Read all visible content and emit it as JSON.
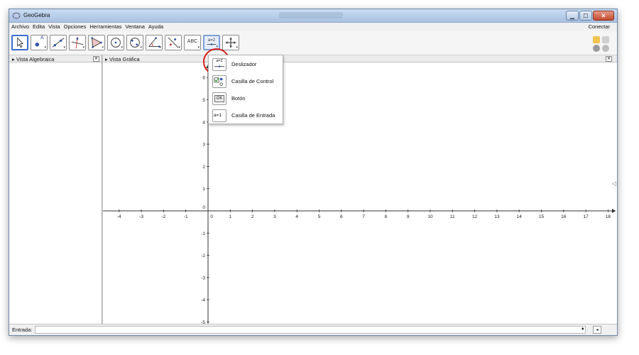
{
  "window": {
    "title": "GeoGebra",
    "controls": {
      "minimize": "▁",
      "maximize": "☐",
      "close": "✕"
    }
  },
  "menubar": {
    "items": [
      "Archivo",
      "Edita",
      "Vista",
      "Opciones",
      "Herramientas",
      "Ventana",
      "Ayuda"
    ],
    "connect": "Conectar"
  },
  "toolbar": {
    "tools": [
      {
        "name": "move-tool",
        "icon": "pointer-arrow-icon",
        "selected": true
      },
      {
        "name": "point-tool",
        "icon": "point-icon",
        "label": "A"
      },
      {
        "name": "line-tool",
        "icon": "line-through-points-icon"
      },
      {
        "name": "perpendicular-tool",
        "icon": "perpendicular-line-icon"
      },
      {
        "name": "polygon-tool",
        "icon": "polygon-icon"
      },
      {
        "name": "circle-tool",
        "icon": "circle-center-point-icon"
      },
      {
        "name": "conic-tool",
        "icon": "ellipse-icon"
      },
      {
        "name": "angle-tool",
        "icon": "angle-icon"
      },
      {
        "name": "reflect-tool",
        "icon": "reflect-line-icon"
      },
      {
        "name": "text-tool",
        "icon": "text-icon",
        "label": "ABC"
      },
      {
        "name": "slider-tool",
        "icon": "slider-icon",
        "label": "a=2"
      },
      {
        "name": "move-view-tool",
        "icon": "move-graphics-view-icon"
      }
    ]
  },
  "panels": {
    "algebra": {
      "title": "Vista Algebraica"
    },
    "graphics": {
      "title": "Vista Gráfica"
    }
  },
  "dropdown": {
    "items": [
      {
        "label": "Deslizador",
        "icon": "slider-icon",
        "icon_text": "a=2"
      },
      {
        "label": "Casilla de Control",
        "icon": "checkbox-icon"
      },
      {
        "label": "Botón",
        "icon": "button-icon",
        "icon_text": "OK"
      },
      {
        "label": "Casilla de Entrada",
        "icon": "input-box-icon",
        "icon_text": "a=1"
      }
    ]
  },
  "axes": {
    "x_ticks": [
      -4,
      -3,
      -2,
      -1,
      0,
      1,
      2,
      3,
      4,
      5,
      6,
      7,
      8,
      9,
      10,
      11,
      12,
      13,
      14,
      15,
      16,
      17,
      18
    ],
    "y_ticks": [
      6,
      5,
      4,
      3,
      2,
      1,
      0,
      -1,
      -2,
      -3,
      -4,
      -5
    ]
  },
  "inputbar": {
    "label": "Entrada:",
    "value": ""
  },
  "colors": {
    "highlight": "#d81c1c",
    "selected_tool_border": "#3b6fd0"
  }
}
